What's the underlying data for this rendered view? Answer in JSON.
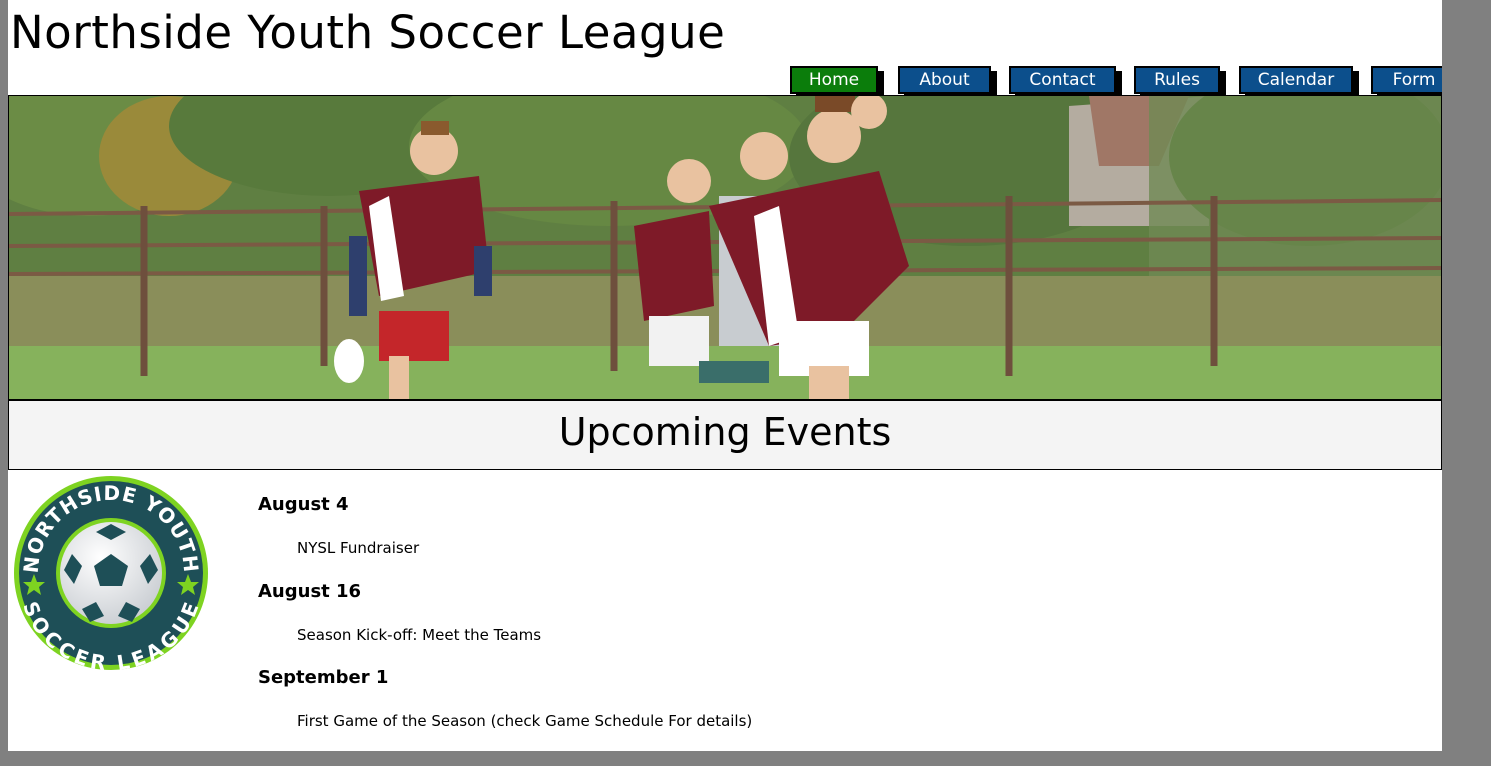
{
  "site": {
    "title": "Northside Youth Soccer League"
  },
  "nav": {
    "items": [
      {
        "label": "Home",
        "active": true
      },
      {
        "label": "About",
        "active": false
      },
      {
        "label": "Contact",
        "active": false
      },
      {
        "label": "Rules",
        "active": false
      },
      {
        "label": "Calendar",
        "active": false
      },
      {
        "label": "Form",
        "active": false
      }
    ],
    "colors": {
      "default": "#0c4f8c",
      "active": "#0b7d0b"
    }
  },
  "hero": {
    "icon": "soccer-kids-photo"
  },
  "events": {
    "heading": "Upcoming Events",
    "items": [
      {
        "date": "August 4",
        "description": "NYSL Fundraiser"
      },
      {
        "date": "August 16",
        "description": "Season Kick-off: Meet the Teams"
      },
      {
        "date": "September 1",
        "description": "First Game of the Season (check Game Schedule For details)"
      }
    ]
  },
  "logo": {
    "top_text": "NORTHSIDE YOUTH",
    "bottom_text": "SOCCER LEAGUE",
    "colors": {
      "ring": "#1e4f57",
      "accent": "#7ed321"
    }
  }
}
